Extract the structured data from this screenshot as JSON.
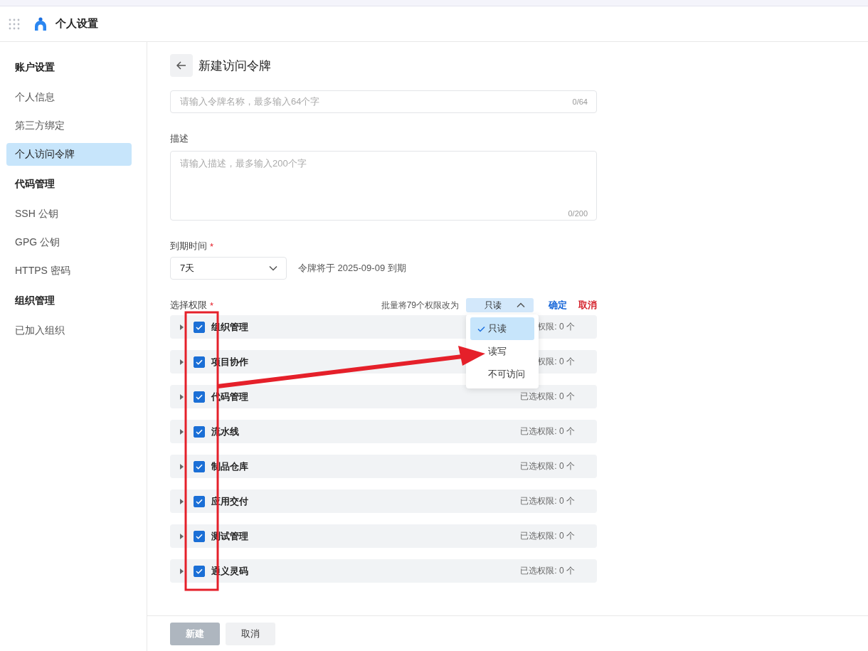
{
  "app": {
    "title": "个人设置"
  },
  "sidebar": {
    "groups": [
      {
        "heading": "账户设置",
        "items": [
          {
            "label": "个人信息",
            "selected": false
          },
          {
            "label": "第三方绑定",
            "selected": false
          },
          {
            "label": "个人访问令牌",
            "selected": true
          }
        ]
      },
      {
        "heading": "代码管理",
        "items": [
          {
            "label": "SSH 公钥",
            "selected": false
          },
          {
            "label": "GPG 公钥",
            "selected": false
          },
          {
            "label": "HTTPS 密码",
            "selected": false
          }
        ]
      },
      {
        "heading": "组织管理",
        "items": [
          {
            "label": "已加入组织",
            "selected": false
          }
        ]
      }
    ]
  },
  "page": {
    "title": "新建访问令牌"
  },
  "name_field": {
    "placeholder": "请输入令牌名称，最多输入64个字",
    "counter": "0/64"
  },
  "description": {
    "label": "描述",
    "placeholder": "请输入描述，最多输入200个字",
    "counter": "0/200"
  },
  "expiry": {
    "label": "到期时间",
    "required_mark": "*",
    "value": "7天",
    "note": "令牌将于 2025-09-09 到期"
  },
  "permissions": {
    "label": "选择权限",
    "required_mark": "*",
    "batch_label": "批量将79个权限改为",
    "batch_value": "只读",
    "expanded": true,
    "confirm": "确定",
    "cancel": "取消",
    "options": [
      {
        "label": "只读",
        "selected": true
      },
      {
        "label": "读写",
        "selected": false
      },
      {
        "label": "不可访问",
        "selected": false
      }
    ],
    "groups": [
      {
        "name": "组织管理",
        "checked": true,
        "count": "权限: 0 个"
      },
      {
        "name": "项目协作",
        "checked": true,
        "count": "权限: 0 个"
      },
      {
        "name": "代码管理",
        "checked": true,
        "count": "已选权限: 0 个"
      },
      {
        "name": "流水线",
        "checked": true,
        "count": "已选权限: 0 个"
      },
      {
        "name": "制品仓库",
        "checked": true,
        "count": "已选权限: 0 个"
      },
      {
        "name": "应用交付",
        "checked": true,
        "count": "已选权限: 0 个"
      },
      {
        "name": "测试管理",
        "checked": true,
        "count": "已选权限: 0 个"
      },
      {
        "name": "通义灵码",
        "checked": true,
        "count": "已选权限: 0 个"
      }
    ]
  },
  "footer": {
    "buttons": [
      {
        "label": "新建",
        "disabled": true
      },
      {
        "label": "取消",
        "disabled": false
      }
    ]
  }
}
